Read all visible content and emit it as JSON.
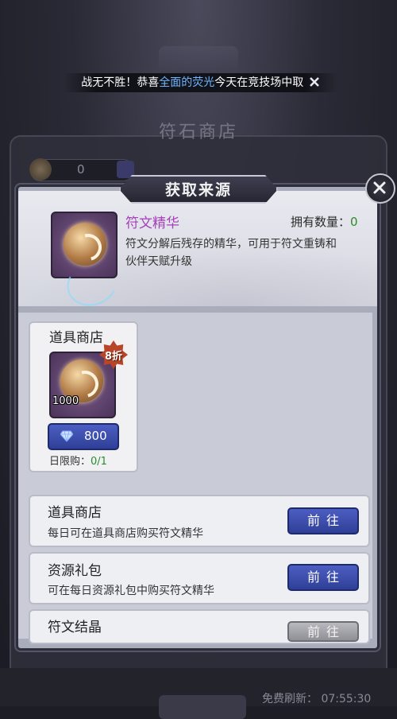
{
  "announcement": {
    "prefix": "战无不胜！恭喜",
    "player": "全面的荧光",
    "suffix": "今天在竞技场中取"
  },
  "background": {
    "shop_title": "符石商店",
    "currency_value": "0",
    "free_refresh": "免费刷新：  07:55:30"
  },
  "popup": {
    "title": "获取来源",
    "item": {
      "name": "符文精华",
      "own_label": "拥有数量：",
      "own_count": "0",
      "description": "符文分解后残存的精华，可用于符文重铸和伙伴天赋升级"
    },
    "shop_card": {
      "title": "道具商店",
      "discount": "8折",
      "quantity": "1000",
      "price": "800",
      "limit_label": "日限购：",
      "limit_value": "0/1"
    },
    "sources": [
      {
        "title": "道具商店",
        "desc": "每日可在道具商店购买符文精华",
        "button": "前往",
        "enabled": true
      },
      {
        "title": "资源礼包",
        "desc": "可在每日资源礼包中购买符文精华",
        "button": "前往",
        "enabled": true
      },
      {
        "title": "符文结晶",
        "desc": "",
        "button": "前往",
        "enabled": false
      }
    ]
  },
  "colors": {
    "accent_blue": "#3b4fb0",
    "item_name_purple": "#a63fb9",
    "count_green": "#2c8a2c",
    "highlight_blue": "#6fb6ff"
  }
}
